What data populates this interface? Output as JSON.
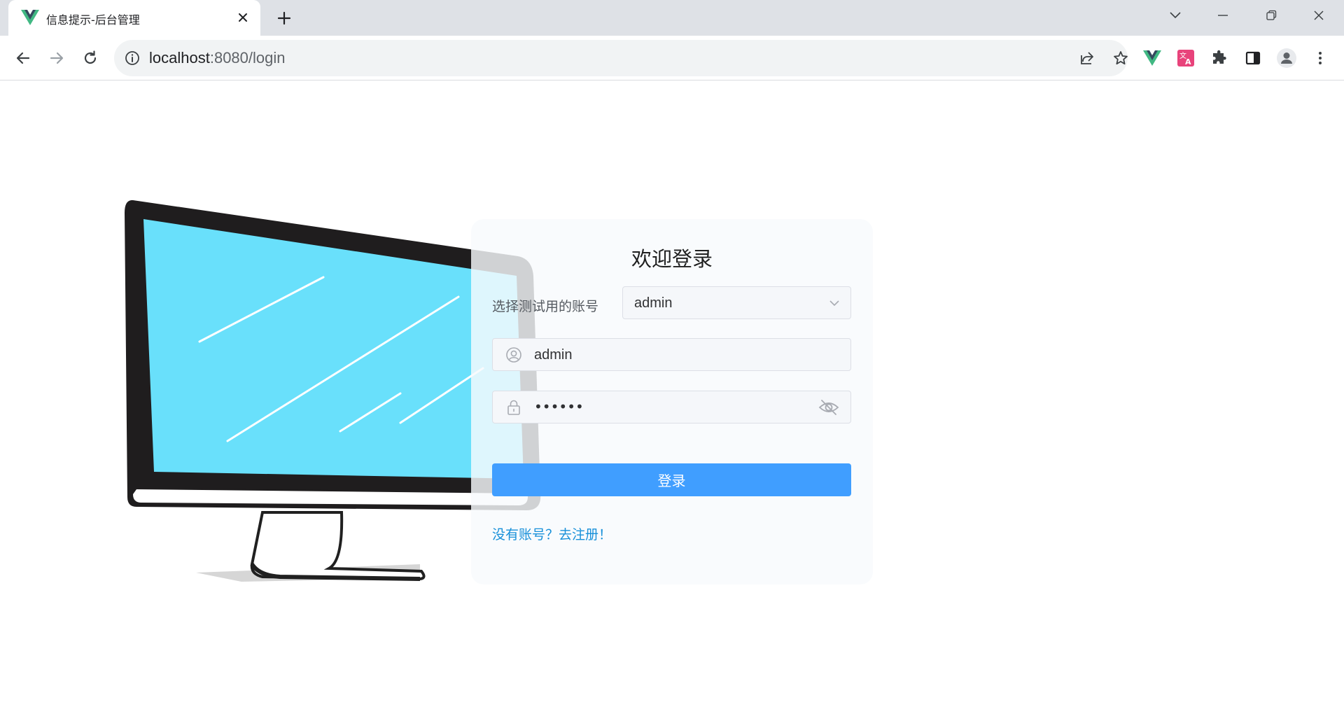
{
  "browser": {
    "tab_title": "信息提示-后台管理",
    "url_host": "localhost",
    "url_rest": ":8080/login",
    "icons": {
      "tab_favicon": "vue-logo-icon",
      "tab_close": "close-icon",
      "new_tab": "plus-icon",
      "tab_search": "chevron-down-icon",
      "minimize": "minimize-icon",
      "restore": "restore-icon",
      "close_window": "close-icon",
      "back": "arrow-left-icon",
      "forward": "arrow-right-icon",
      "reload": "reload-icon",
      "site_info": "info-icon",
      "share": "share-icon",
      "bookmark": "star-icon",
      "vue_devtools": "vue-logo-icon",
      "translate": "translate-icon",
      "extensions": "puzzle-icon",
      "side_panel": "side-panel-icon",
      "profile": "profile-icon",
      "menu": "more-vert-icon"
    }
  },
  "login": {
    "title": "欢迎登录",
    "account_select_label": "选择测试用的账号",
    "account_select_value": "admin",
    "username_value": "admin",
    "password_masked": "••••••",
    "submit_label": "登录",
    "register_link": "没有账号？去注册！"
  },
  "colors": {
    "primary_button": "#409eff",
    "link": "#1890d9",
    "monitor_screen": "#69e0fb"
  }
}
